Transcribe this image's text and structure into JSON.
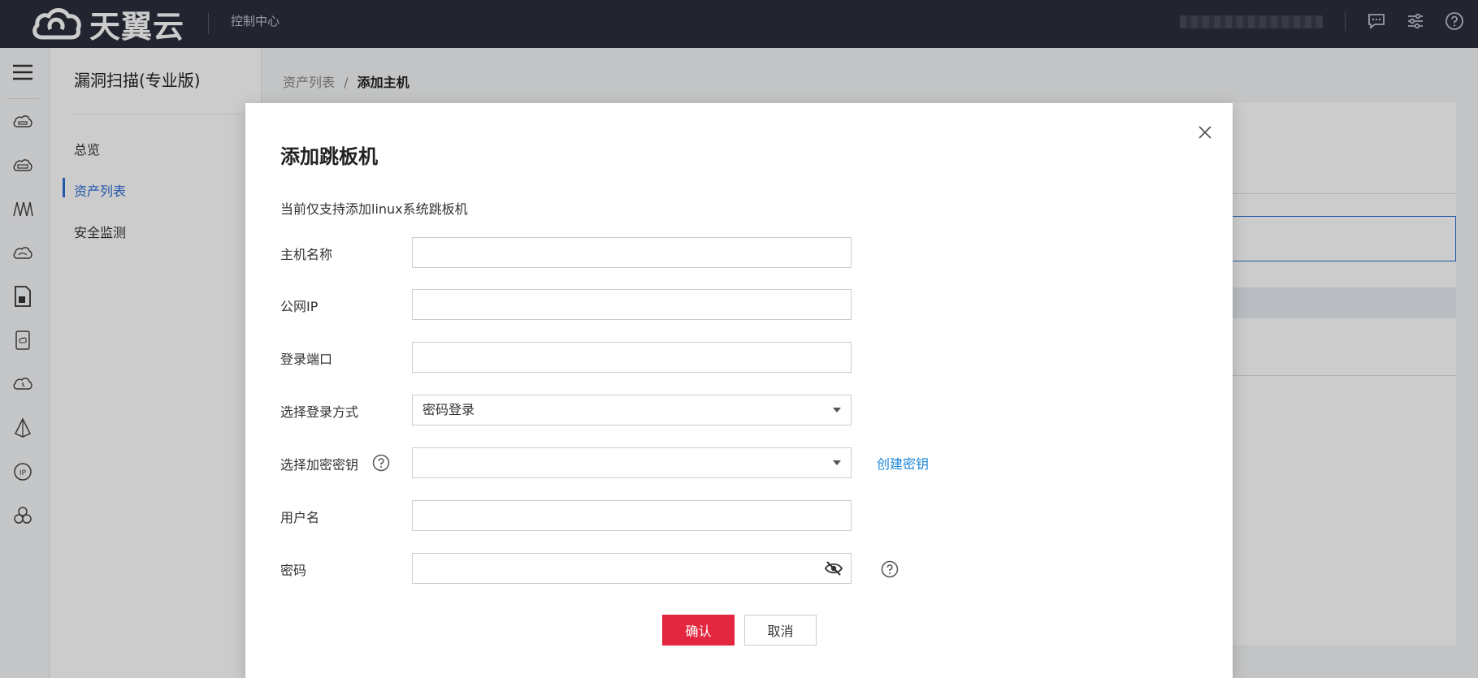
{
  "topbar": {
    "brand": "天翼云",
    "console_link": "控制中心",
    "icons": [
      "message-icon",
      "settings-sliders-icon",
      "help-icon"
    ]
  },
  "rail": {
    "icons": [
      "cloud-server-icon",
      "cloud-host-icon",
      "network-icon",
      "cloud-icon",
      "document-icon",
      "storage-icon",
      "cloud-monitor-icon",
      "sail-icon",
      "ip-icon",
      "cluster-icon"
    ]
  },
  "subnav": {
    "title": "漏洞扫描(专业版)",
    "items": [
      {
        "label": "总览",
        "active": false
      },
      {
        "label": "资产列表",
        "active": true
      },
      {
        "label": "安全监测",
        "active": false
      }
    ]
  },
  "breadcrumb": {
    "parent": "资产列表",
    "separator": "/",
    "current": "添加主机"
  },
  "modal": {
    "title": "添加跳板机",
    "note": "当前仅支持添加linux系统跳板机",
    "fields": {
      "host_name": {
        "label": "主机名称",
        "value": ""
      },
      "public_ip": {
        "label": "公网IP",
        "value": ""
      },
      "login_port": {
        "label": "登录端口",
        "value": ""
      },
      "login_method": {
        "label": "选择登录方式",
        "value": "密码登录"
      },
      "encryption_key": {
        "label": "选择加密密钥",
        "value": ""
      },
      "username": {
        "label": "用户名",
        "value": ""
      },
      "password": {
        "label": "密码",
        "value": ""
      }
    },
    "create_key_link": "创建密钥",
    "confirm_label": "确认",
    "cancel_label": "取消"
  },
  "colors": {
    "topbar_bg": "#2b2e3d",
    "accent_blue": "#2f6fd6",
    "link_blue": "#1e88d6",
    "confirm_red": "#e2273e"
  }
}
